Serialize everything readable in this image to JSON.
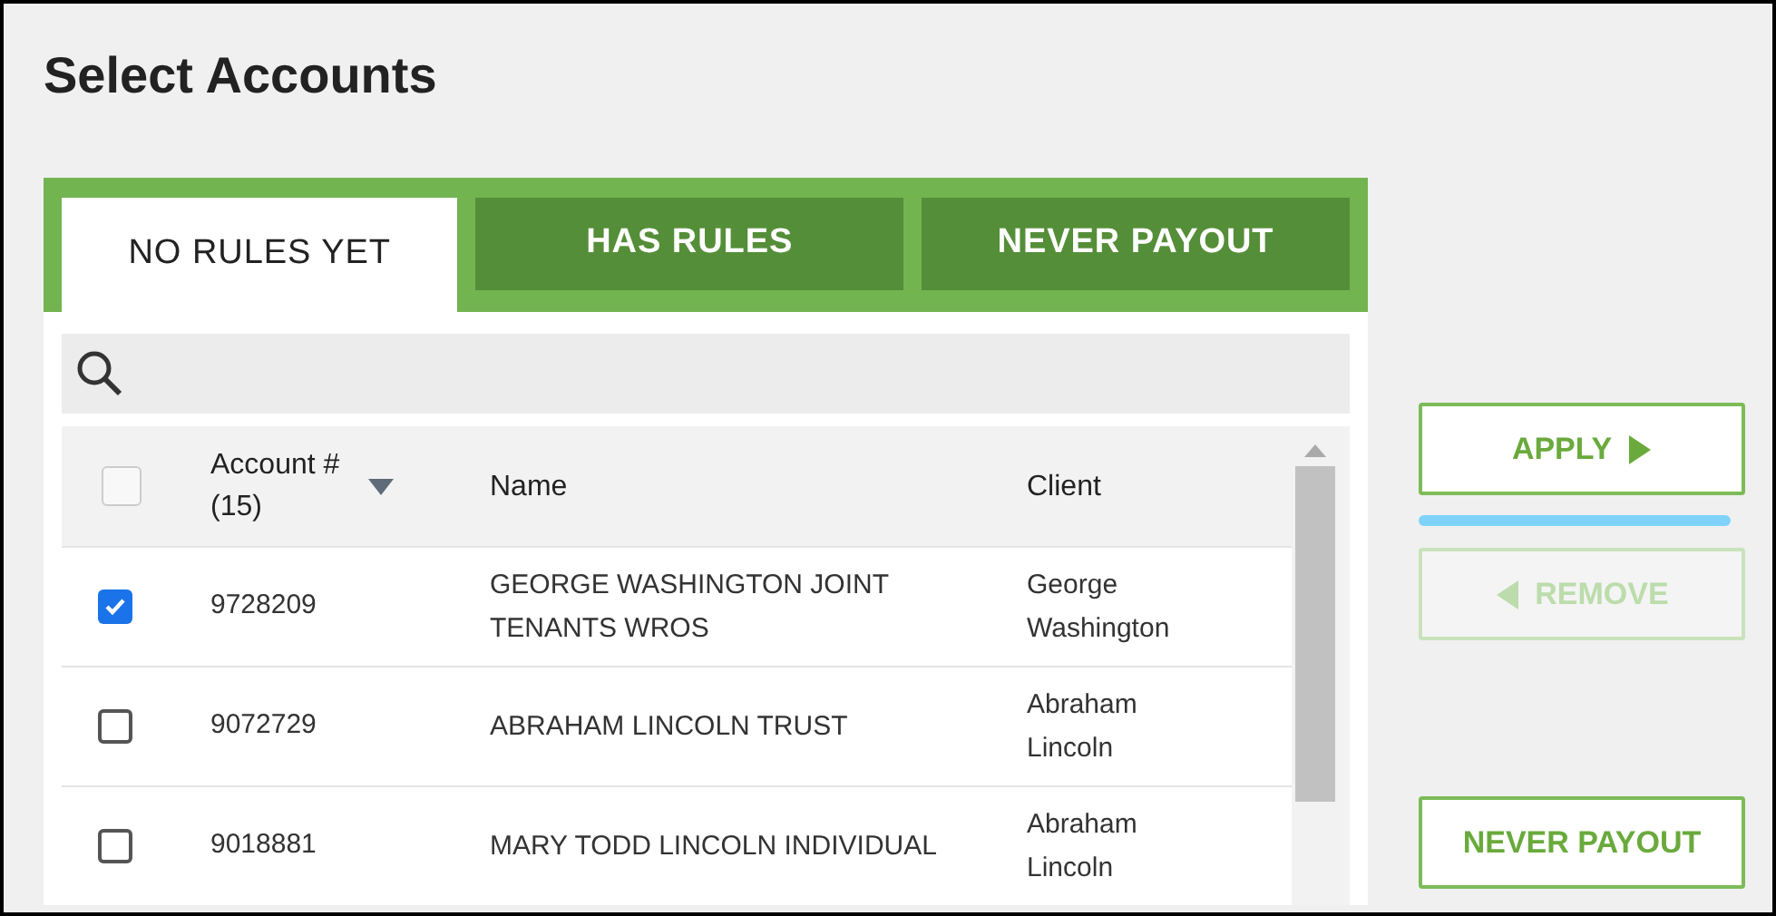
{
  "title": "Select Accounts",
  "tabs": [
    {
      "label": "NO RULES YET",
      "selected": true
    },
    {
      "label": "HAS RULES",
      "selected": false
    },
    {
      "label": "NEVER PAYOUT",
      "selected": false
    }
  ],
  "table": {
    "select_all_checked": false,
    "columns": [
      {
        "label": "Account #\n(15)",
        "sorted": true
      },
      {
        "label": "Name",
        "sorted": false
      },
      {
        "label": "Client",
        "sorted": false
      }
    ],
    "rows": [
      {
        "checked": true,
        "account": "9728209",
        "name": "GEORGE WASHINGTON JOINT TENANTS WROS",
        "client": "George Washington"
      },
      {
        "checked": false,
        "account": "9072729",
        "name": "ABRAHAM LINCOLN TRUST",
        "client": "Abraham Lincoln"
      },
      {
        "checked": false,
        "account": "9018881",
        "name": "MARY TODD LINCOLN INDIVIDUAL",
        "client": "Abraham Lincoln"
      }
    ]
  },
  "actions": [
    {
      "label": "APPLY",
      "kind": "apply",
      "disabled": false
    },
    {
      "label": "REMOVE",
      "kind": "remove",
      "disabled": true
    },
    {
      "label": "NEVER PAYOUT",
      "kind": "plain",
      "disabled": false
    }
  ]
}
